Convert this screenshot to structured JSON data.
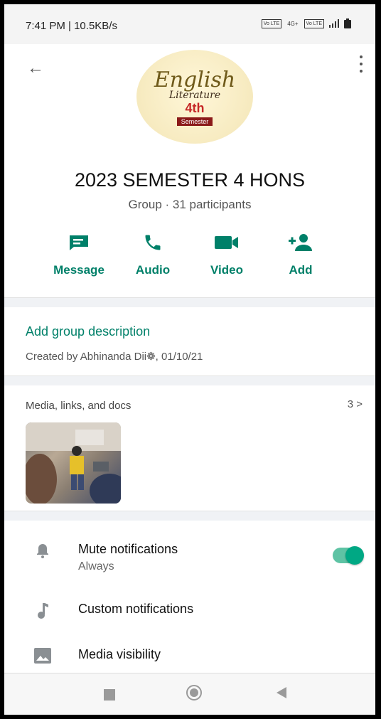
{
  "status_bar": {
    "time": "7:41 PM | 10.5KB/s",
    "icons": [
      "volte-icon",
      "4g-signal-icon",
      "volte-icon",
      "signal-icon",
      "battery-icon"
    ],
    "icon_labels": [
      "Vo LTE",
      "4G+",
      "Vo LTE"
    ]
  },
  "header": {
    "avatar": {
      "line1": "English",
      "line2": "Literature",
      "badge": "4th",
      "caption": "Semester"
    },
    "group_name": "2023 SEMESTER 4 HONS",
    "subtitle": "Group · 31 participants",
    "actions": [
      {
        "label": "Message",
        "icon": "message-icon"
      },
      {
        "label": "Audio",
        "icon": "phone-icon"
      },
      {
        "label": "Video",
        "icon": "video-icon"
      },
      {
        "label": "Add",
        "icon": "add-person-icon"
      }
    ]
  },
  "description": {
    "add_label": "Add group description",
    "created_by": "Created by Abhinanda Dii❁, 01/10/21"
  },
  "media": {
    "header": "Media, links, and docs",
    "count": "3 >"
  },
  "settings": [
    {
      "label": "Mute notifications",
      "sub": "Always",
      "icon": "bell-icon",
      "toggle_on": true
    },
    {
      "label": "Custom notifications",
      "icon": "music-note-icon"
    },
    {
      "label": "Media visibility",
      "icon": "image-icon"
    }
  ],
  "colors": {
    "accent": "#008069",
    "toggle_track": "#5ec3a4",
    "toggle_knob": "#00a884",
    "section_gap": "#f0f2f5"
  }
}
